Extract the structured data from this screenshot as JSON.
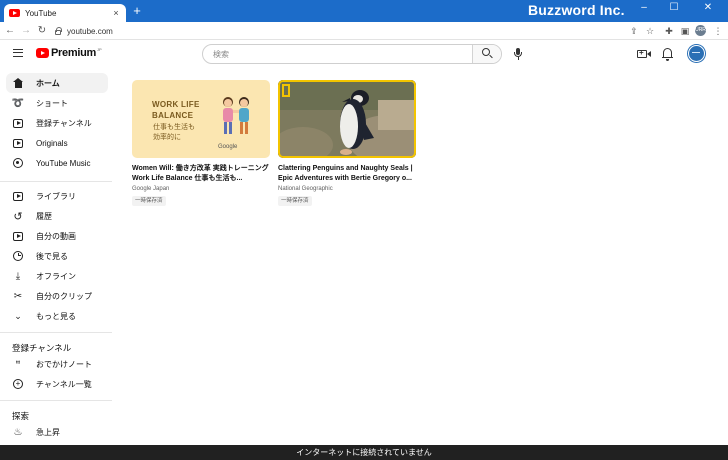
{
  "browser": {
    "tab_title": "YouTube",
    "tab_close": "×",
    "new_tab": "+",
    "brand": "Buzzword Inc.",
    "window_controls": [
      "–",
      "☐",
      "✕"
    ],
    "url": "youtube.com",
    "profile_initials": "URR",
    "accent_color": "#1c6cc9"
  },
  "header": {
    "logo_text": "Premium",
    "logo_suffix": "JP",
    "search_placeholder": "検索"
  },
  "sidebar": {
    "main": [
      {
        "label": "ホーム",
        "icon": "home-icon",
        "active": true
      },
      {
        "label": "ショート",
        "icon": "shorts-icon"
      },
      {
        "label": "登録チャンネル",
        "icon": "subscriptions-icon"
      },
      {
        "label": "Originals",
        "icon": "originals-icon"
      },
      {
        "label": "YouTube Music",
        "icon": "music-icon"
      }
    ],
    "library": [
      {
        "label": "ライブラリ",
        "icon": "library-icon"
      },
      {
        "label": "履歴",
        "icon": "history-icon"
      },
      {
        "label": "自分の動画",
        "icon": "your-videos-icon"
      },
      {
        "label": "後で見る",
        "icon": "watch-later-icon"
      },
      {
        "label": "オフライン",
        "icon": "download-icon"
      },
      {
        "label": "自分のクリップ",
        "icon": "clips-icon"
      },
      {
        "label": "もっと見る",
        "icon": "chevron-down-icon"
      }
    ],
    "subscriptions_heading": "登録チャンネル",
    "subscriptions": [
      {
        "label": "おでかけノート",
        "icon": "channel-avatar-icon"
      },
      {
        "label": "チャンネル一覧",
        "icon": "add-circle-icon"
      }
    ],
    "explore_heading": "探索",
    "explore": [
      {
        "label": "急上昇",
        "icon": "trending-icon"
      }
    ]
  },
  "videos": [
    {
      "title": "Women Will: 働き方改革 実践トレーニング Work Life Balance 仕事も生活も...",
      "channel": "Google Japan",
      "badge": "一時保存済",
      "thumb_title": "WORK LIFE\nBALANCE",
      "thumb_sub": "仕事も生活も\n効率的に",
      "thumb_brand": "Google"
    },
    {
      "title": "Clattering Penguins and Naughty Seals | Epic Adventures with Bertie Gregory o...",
      "channel": "National Geographic",
      "badge": "一時保存済"
    }
  ],
  "offline_message": "インターネットに接続されていません"
}
